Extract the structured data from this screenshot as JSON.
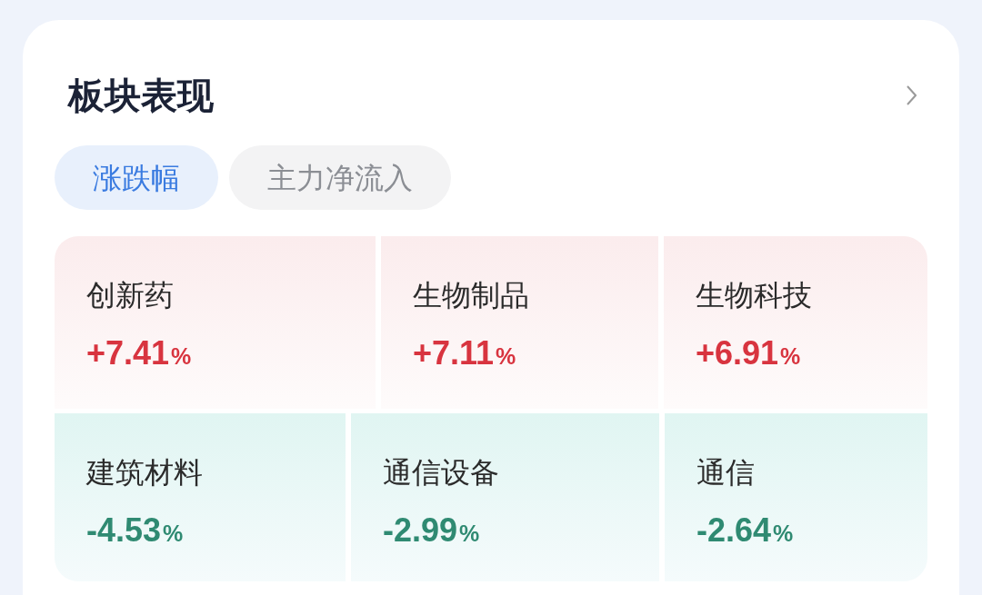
{
  "card": {
    "title": "板块表现"
  },
  "tabs": [
    {
      "label": "涨跌幅",
      "selected": true
    },
    {
      "label": "主力净流入",
      "selected": false
    }
  ],
  "sectors": [
    {
      "name": "创新药",
      "value": "+7.41",
      "unit": "%",
      "kind": "rise"
    },
    {
      "name": "生物制品",
      "value": "+7.11",
      "unit": "%",
      "kind": "rise"
    },
    {
      "name": "生物科技",
      "value": "+6.91",
      "unit": "%",
      "kind": "rise"
    },
    {
      "name": "建筑材料",
      "value": "-4.53",
      "unit": "%",
      "kind": "fall"
    },
    {
      "name": "通信设备",
      "value": "-2.99",
      "unit": "%",
      "kind": "fall"
    },
    {
      "name": "通信",
      "value": "-2.64",
      "unit": "%",
      "kind": "fall"
    }
  ]
}
